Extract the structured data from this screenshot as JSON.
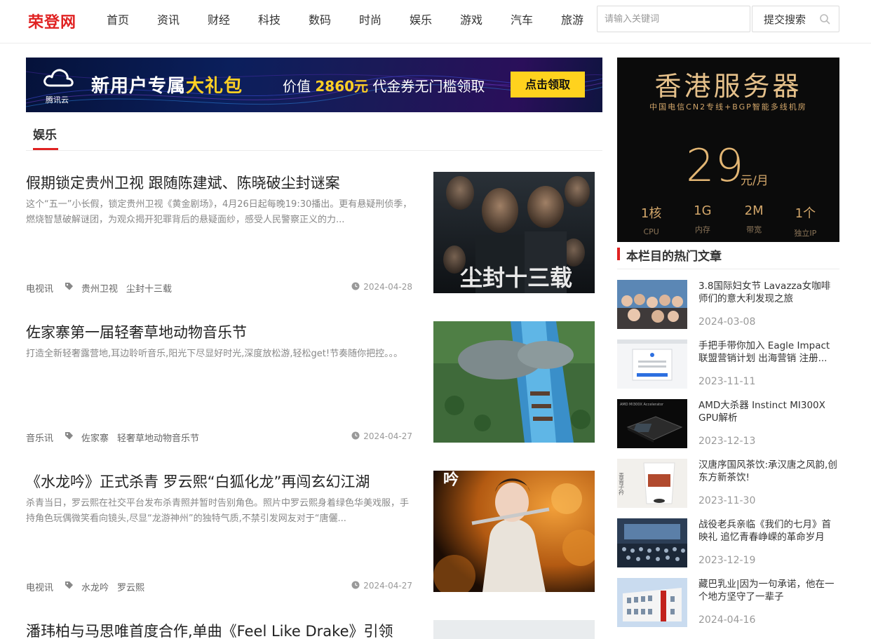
{
  "site": {
    "logo": "荣登网",
    "brand_color": "#e02222"
  },
  "nav": [
    "首页",
    "资讯",
    "财经",
    "科技",
    "数码",
    "时尚",
    "娱乐",
    "游戏",
    "汽车",
    "旅游"
  ],
  "search": {
    "placeholder": "请输入关键词",
    "button_label": "提交搜索"
  },
  "banner": {
    "logo_text": "腾讯云",
    "headline_prefix": "新用户专属",
    "headline_highlight": "大礼包",
    "offer_prefix": "价值",
    "offer_amount": "2860元",
    "offer_suffix": "代金券无门槛领取",
    "cta": "点击领取"
  },
  "section": {
    "title": "娱乐"
  },
  "articles": [
    {
      "title": "假期锁定贵州卫视 跟随陈建斌、陈晓破尘封谜案",
      "desc": "这个“五一”小长假，锁定贵州卫视《黄金剧场》，4月26日起每晚19:30播出。更有悬疑刑侦季，燃烧智慧破解谜团，为观众揭开犯罪背后的悬疑面纱，感受人民警察正义的力...",
      "category": "电视讯",
      "tags": [
        "贵州卫视",
        "尘封十三载"
      ],
      "date": "2024-04-28",
      "thumb_text": "尘封十三载"
    },
    {
      "title": "佐家寨第一届轻奢草地动物音乐节",
      "desc": "打造全新轻奢露营地,耳边聆听音乐,阳光下尽显好时光,深度放松游,轻松get!节奏随你把控。。。",
      "category": "音乐讯",
      "tags": [
        "佐家寨",
        "轻奢草地动物音乐节"
      ],
      "date": "2024-04-27"
    },
    {
      "title": "《水龙吟》正式杀青 罗云熙“白狐化龙”再闯玄幻江湖",
      "desc": "杀青当日，罗云熙在社交平台发布杀青照并暂时告别角色。照片中罗云熙身着绿色华美戏服，手持角色玩偶微笑看向镜头,尽显“龙游神州”的独特气质,不禁引发网友对于“唐儷...",
      "category": "电视讯",
      "tags": [
        "水龙吟",
        "罗云熙"
      ],
      "date": "2024-04-27",
      "thumb_text": "吟"
    },
    {
      "title": "潘玮柏与马思唯首度合作,单曲《Feel Like Drake》引领"
    }
  ],
  "side_ad": {
    "title": "香港服务器",
    "subtitle": "中国电信CN2专线+BGP智能多线机房",
    "price": "29",
    "unit": "元/月",
    "specs": [
      {
        "value": "1核",
        "label": "CPU"
      },
      {
        "value": "1G",
        "label": "内存"
      },
      {
        "value": "2M",
        "label": "带宽"
      },
      {
        "value": "1个",
        "label": "独立IP"
      }
    ]
  },
  "hot": {
    "heading": "本栏目的热门文章",
    "items": [
      {
        "title": "3.8国际妇女节 Lavazza女咖啡师们的意大利发现之旅",
        "date": "2024-03-08"
      },
      {
        "title": "手把手带你加入 Eagle Impact 联盟营销计划 出海营销 注册...",
        "date": "2023-11-11"
      },
      {
        "title": "AMD大杀器 Instinct MI300X GPU解析",
        "date": "2023-12-13",
        "img_text": "AMD MI300X Accelerator"
      },
      {
        "title": "汉唐序国风茶饮:承汉唐之风韵,创东方新茶饮!",
        "date": "2023-11-30",
        "img_text": "青青子衿"
      },
      {
        "title": "战役老兵亲临《我们的七月》首映礼 追忆青春峥嵘的革命岁月",
        "date": "2023-12-19"
      },
      {
        "title": "藏巴乳业|因为一句承诺，他在一个地方坚守了一辈子",
        "date": "2024-04-16"
      }
    ]
  }
}
